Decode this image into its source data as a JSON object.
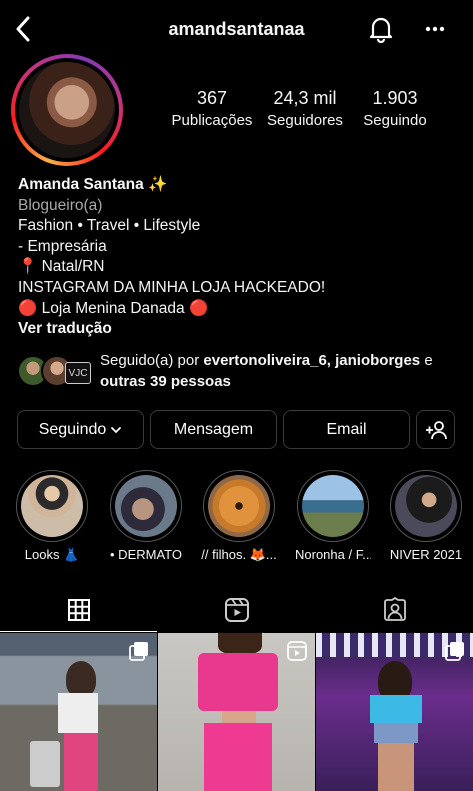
{
  "header": {
    "username": "amandsantanaa",
    "back_icon": "chevron-left-icon",
    "bell_icon": "bell-icon",
    "more_icon": "more-horizontal-icon"
  },
  "stats": [
    {
      "value": "367",
      "label": "Publicações"
    },
    {
      "value": "24,3 mil",
      "label": "Seguidores"
    },
    {
      "value": "1.903",
      "label": "Seguindo"
    }
  ],
  "bio": {
    "name": "Amanda Santana ✨",
    "category": "Blogueiro(a)",
    "lines": [
      "Fashion • Travel • Lifestyle",
      "- Empresária",
      "📍 Natal/RN",
      "INSTAGRAM DA MINHA LOJA HACKEADO!",
      "🔴 Loja Menina Danada 🔴"
    ],
    "translate": "Ver tradução"
  },
  "followed_by": {
    "prefix": "Seguido(a) por ",
    "names": "evertonoliveira_6, janioborges",
    "joiner": " e ",
    "others": "outras 39 pessoas"
  },
  "buttons": {
    "following": "Seguindo",
    "message": "Mensagem",
    "email": "Email"
  },
  "highlights": [
    {
      "label": "Looks 👗"
    },
    {
      "label": "• DERMATO"
    },
    {
      "label": "// filhos. 🦊..."
    },
    {
      "label": "Noronha / F..."
    },
    {
      "label": "NIVER 2021"
    }
  ],
  "tabs": [
    {
      "name": "grid-icon"
    },
    {
      "name": "reels-icon"
    },
    {
      "name": "tagged-icon"
    }
  ],
  "colors": {
    "background": "#000000",
    "story_ring": "#fd1d1d",
    "border": "#3a3a3a",
    "secondary_text": "#a8a8a8"
  }
}
